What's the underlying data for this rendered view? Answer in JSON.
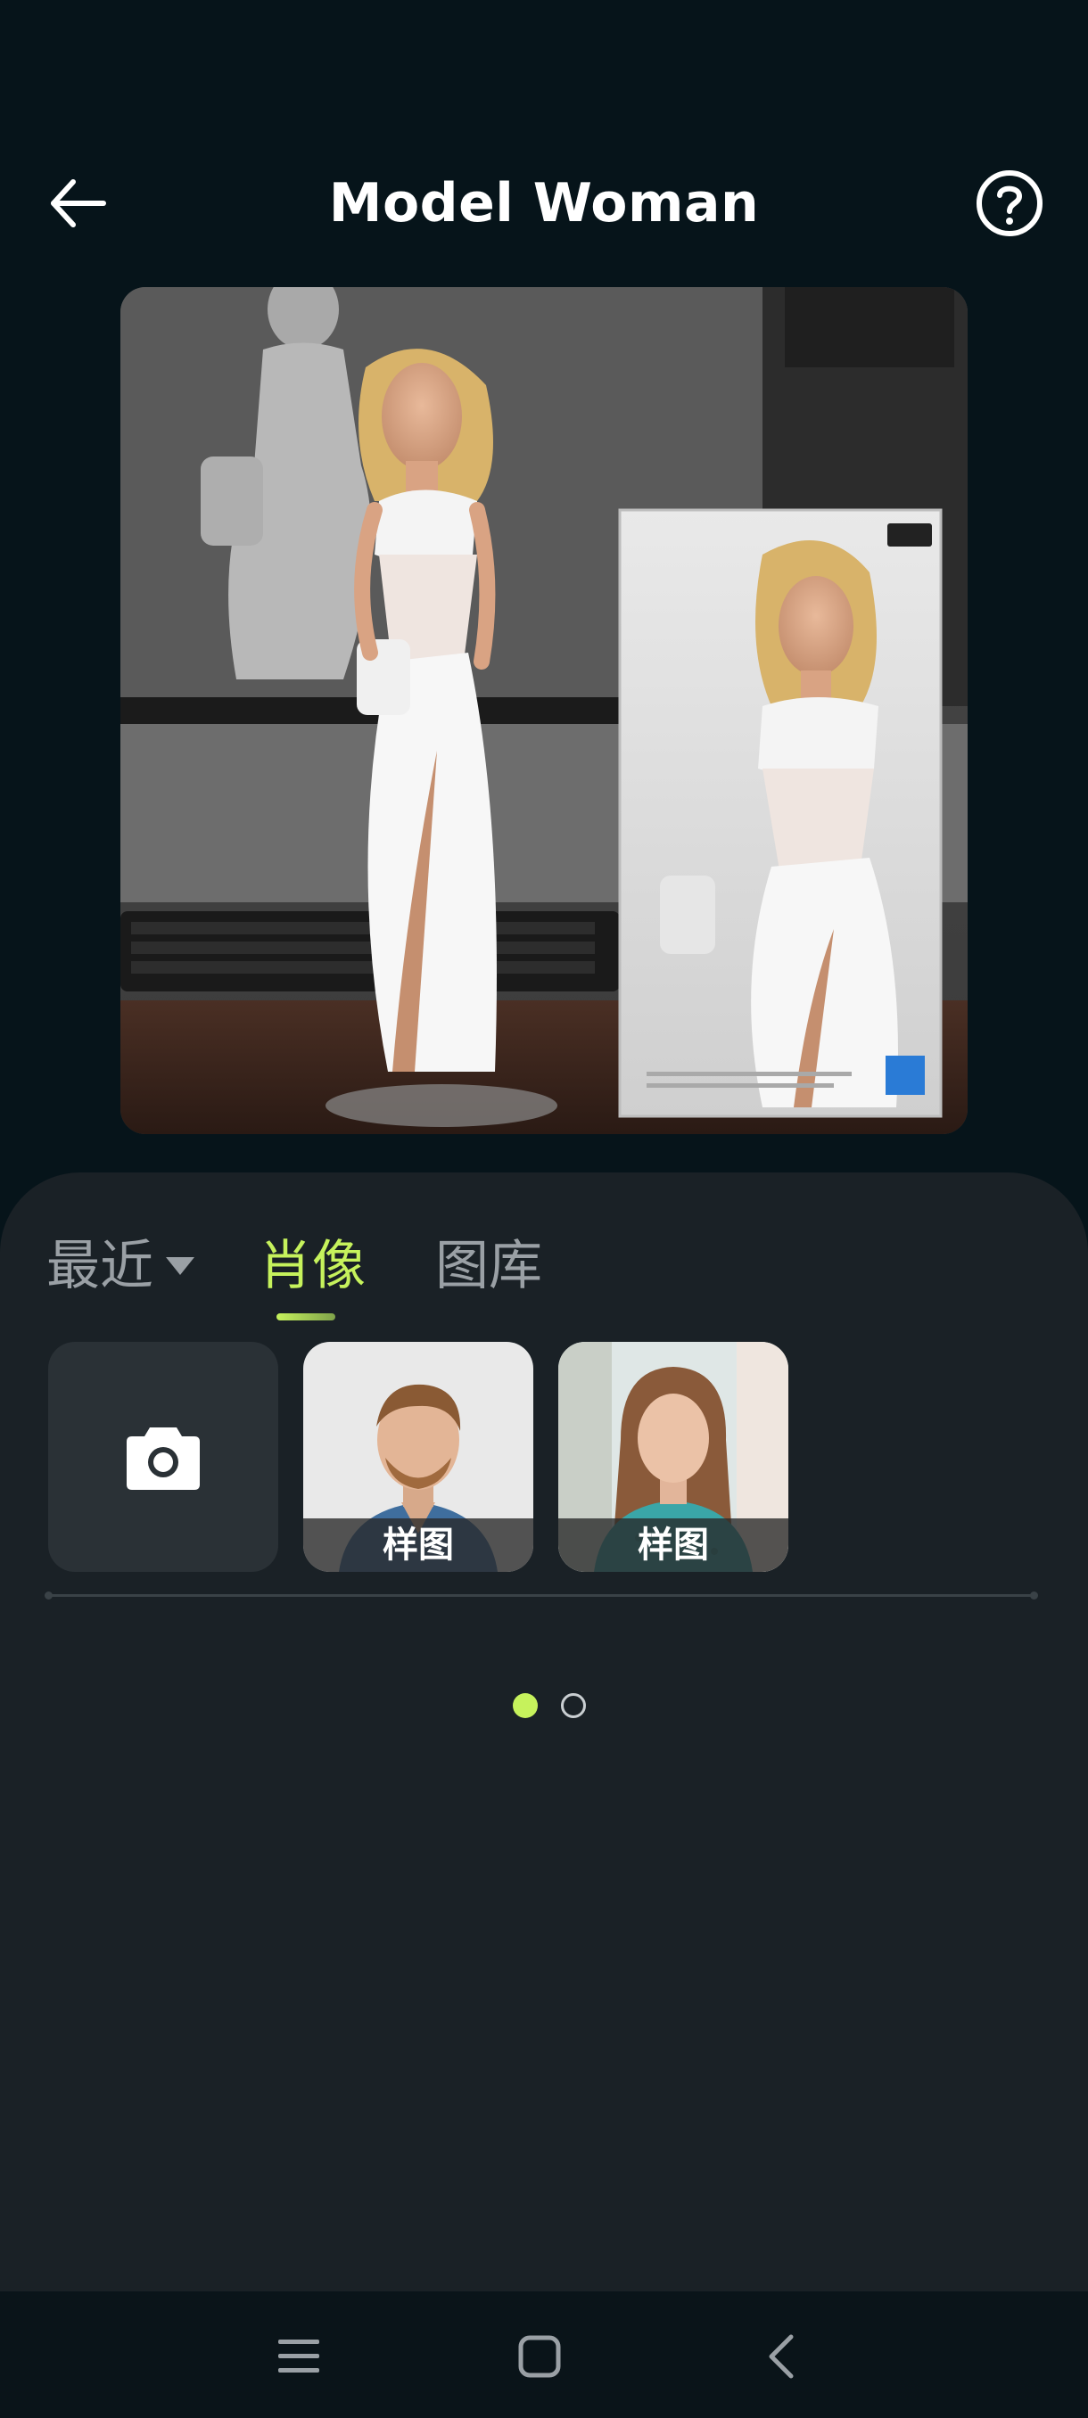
{
  "header": {
    "title": "Model Woman",
    "back_icon": "back-arrow-icon",
    "help_icon": "help-circle-icon"
  },
  "preview": {
    "description_icon": "figure-preview-image"
  },
  "tabs": {
    "recent": "最近",
    "portrait": "肖像",
    "gallery": "图库",
    "active": "portrait"
  },
  "thumbnails": [
    {
      "type": "camera",
      "icon": "camera-icon"
    },
    {
      "type": "sample",
      "label": "样图"
    },
    {
      "type": "sample",
      "label": "样图"
    }
  ],
  "pager": {
    "pages": 2,
    "current": 1
  },
  "colors": {
    "accent": "#c6f25c",
    "background": "#06141a",
    "panel": "#1a2126"
  },
  "system_nav": {
    "recent_apps_icon": "menu-lines-icon",
    "home_icon": "home-square-icon",
    "back_icon": "chevron-left-icon"
  }
}
